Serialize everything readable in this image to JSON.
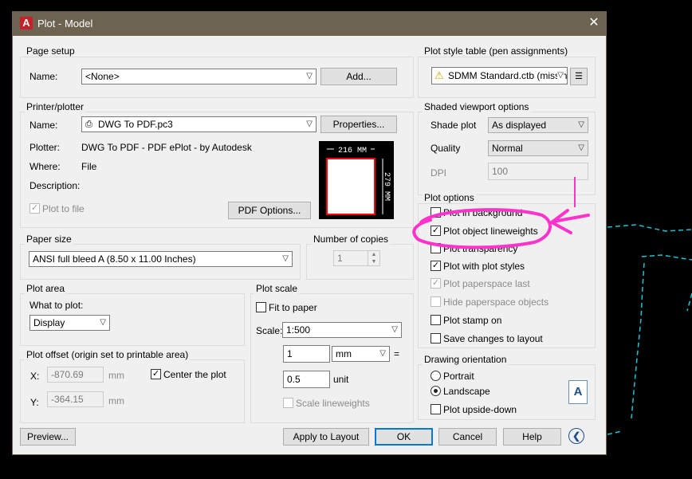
{
  "window": {
    "title": "Plot - Model",
    "close_glyph": "✕",
    "logo_letter": "A"
  },
  "page_setup": {
    "group_label": "Page setup",
    "name_label": "Name:",
    "name_value": "<None>",
    "add_label": "Add..."
  },
  "printer": {
    "group_label": "Printer/plotter",
    "name_label": "Name:",
    "name_value": "DWG To PDF.pc3",
    "properties_label": "Properties...",
    "plotter_label": "Plotter:",
    "plotter_value": "DWG To PDF - PDF ePlot - by Autodesk",
    "where_label": "Where:",
    "where_value": "File",
    "description_label": "Description:",
    "plot_to_file_label": "Plot to file",
    "pdf_options_label": "PDF Options...",
    "preview_width": "216 MM",
    "preview_height": "279 MM"
  },
  "paper_size": {
    "group_label": "Paper size",
    "value": "ANSI full bleed A (8.50 x 11.00 Inches)"
  },
  "copies": {
    "group_label": "Number of copies",
    "value": "1"
  },
  "plot_area": {
    "group_label": "Plot area",
    "what_label": "What to plot:",
    "what_value": "Display"
  },
  "plot_offset": {
    "group_label": "Plot offset (origin set to printable area)",
    "x_label": "X:",
    "x_value": "-870.69",
    "y_label": "Y:",
    "y_value": "-364.15",
    "unit": "mm",
    "center_label": "Center the plot"
  },
  "plot_scale": {
    "group_label": "Plot scale",
    "fit_label": "Fit to paper",
    "scale_label": "Scale:",
    "scale_value": "1:500",
    "value1": "1",
    "unit1": "mm",
    "equals": "=",
    "value2": "0.5",
    "unit2": "unit",
    "lineweights_label": "Scale lineweights"
  },
  "plot_style": {
    "group_label": "Plot style table (pen assignments)",
    "value": "SDMM Standard.ctb (missing"
  },
  "shaded": {
    "group_label": "Shaded viewport options",
    "shade_label": "Shade plot",
    "shade_value": "As displayed",
    "quality_label": "Quality",
    "quality_value": "Normal",
    "dpi_label": "DPI",
    "dpi_value": "100"
  },
  "plot_options": {
    "group_label": "Plot options",
    "items": [
      {
        "label": "Plot in background",
        "checked": false
      },
      {
        "label": "Plot object lineweights",
        "checked": true
      },
      {
        "label": "Plot transparency",
        "checked": false
      },
      {
        "label": "Plot with plot styles",
        "checked": true
      },
      {
        "label": "Plot paperspace last",
        "checked": true
      },
      {
        "label": "Hide paperspace objects",
        "checked": false
      },
      {
        "label": "Plot stamp on",
        "checked": false
      },
      {
        "label": "Save changes to layout",
        "checked": false
      }
    ]
  },
  "orientation": {
    "group_label": "Drawing orientation",
    "portrait_label": "Portrait",
    "landscape_label": "Landscape",
    "upside_label": "Plot upside-down",
    "selected": "Landscape",
    "icon_letter": "A"
  },
  "buttons": {
    "preview": "Preview...",
    "apply": "Apply to Layout",
    "ok": "OK",
    "cancel": "Cancel",
    "help": "Help"
  },
  "check_glyph": "✓",
  "colors": {
    "title_bar": "#6d6351",
    "annotation": "#ff33cc",
    "cad_lines": "#19c3d6",
    "preview_red": "#ff0000"
  }
}
